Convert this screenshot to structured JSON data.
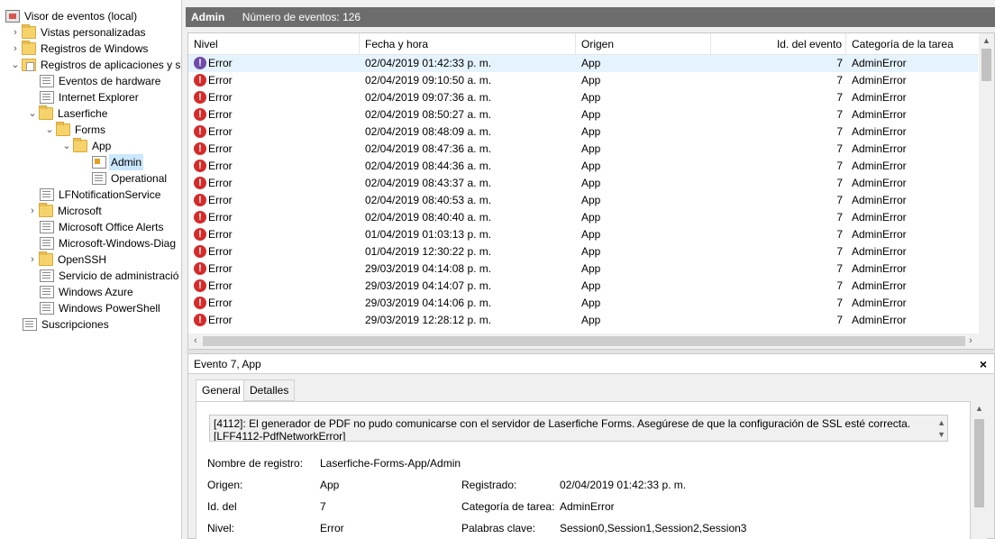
{
  "tree": {
    "items": [
      {
        "label": "Visor de eventos (local)",
        "icon": "event-viewer-icon"
      },
      {
        "label": "Vistas personalizadas",
        "icon": "folder-icon",
        "twisty": "›"
      },
      {
        "label": "Registros de Windows",
        "icon": "folder-icon",
        "twisty": "›"
      },
      {
        "label": "Registros de aplicaciones y s",
        "icon": "log-folder-icon",
        "twisty": "⌄"
      },
      {
        "label": "Eventos de hardware",
        "icon": "log-icon"
      },
      {
        "label": "Internet Explorer",
        "icon": "log-icon"
      },
      {
        "label": "Laserfiche",
        "icon": "folder-icon",
        "twisty": "⌄"
      },
      {
        "label": "Forms",
        "icon": "folder-icon",
        "twisty": "⌄"
      },
      {
        "label": "App",
        "icon": "folder-icon",
        "twisty": "⌄"
      },
      {
        "label": "Admin",
        "icon": "admin-log-icon"
      },
      {
        "label": "Operational",
        "icon": "log-icon"
      },
      {
        "label": "LFNotificationService",
        "icon": "log-icon"
      },
      {
        "label": "Microsoft",
        "icon": "folder-icon",
        "twisty": "›"
      },
      {
        "label": "Microsoft Office Alerts",
        "icon": "log-icon"
      },
      {
        "label": "Microsoft-Windows-Diag",
        "icon": "log-icon"
      },
      {
        "label": "OpenSSH",
        "icon": "folder-icon",
        "twisty": "›"
      },
      {
        "label": "Servicio de administració",
        "icon": "log-icon"
      },
      {
        "label": "Windows Azure",
        "icon": "log-icon"
      },
      {
        "label": "Windows PowerShell",
        "icon": "log-icon"
      },
      {
        "label": "Suscripciones",
        "icon": "log-icon"
      }
    ]
  },
  "header": {
    "title": "Admin",
    "count": "Número de eventos: 126"
  },
  "grid": {
    "columns": [
      "Nivel",
      "Fecha y hora",
      "Origen",
      "Id. del evento",
      "Categoría de la tarea"
    ],
    "rows": [
      {
        "level": "Error",
        "date": "02/04/2019 01:42:33 p. m.",
        "source": "App",
        "id": "7",
        "category": "AdminError"
      },
      {
        "level": "Error",
        "date": "02/04/2019 09:10:50 a. m.",
        "source": "App",
        "id": "7",
        "category": "AdminError"
      },
      {
        "level": "Error",
        "date": "02/04/2019 09:07:36 a. m.",
        "source": "App",
        "id": "7",
        "category": "AdminError"
      },
      {
        "level": "Error",
        "date": "02/04/2019 08:50:27 a. m.",
        "source": "App",
        "id": "7",
        "category": "AdminError"
      },
      {
        "level": "Error",
        "date": "02/04/2019 08:48:09 a. m.",
        "source": "App",
        "id": "7",
        "category": "AdminError"
      },
      {
        "level": "Error",
        "date": "02/04/2019 08:47:36 a. m.",
        "source": "App",
        "id": "7",
        "category": "AdminError"
      },
      {
        "level": "Error",
        "date": "02/04/2019 08:44:36 a. m.",
        "source": "App",
        "id": "7",
        "category": "AdminError"
      },
      {
        "level": "Error",
        "date": "02/04/2019 08:43:37 a. m.",
        "source": "App",
        "id": "7",
        "category": "AdminError"
      },
      {
        "level": "Error",
        "date": "02/04/2019 08:40:53 a. m.",
        "source": "App",
        "id": "7",
        "category": "AdminError"
      },
      {
        "level": "Error",
        "date": "02/04/2019 08:40:40 a. m.",
        "source": "App",
        "id": "7",
        "category": "AdminError"
      },
      {
        "level": "Error",
        "date": "01/04/2019 01:03:13 p. m.",
        "source": "App",
        "id": "7",
        "category": "AdminError"
      },
      {
        "level": "Error",
        "date": "01/04/2019 12:30:22 p. m.",
        "source": "App",
        "id": "7",
        "category": "AdminError"
      },
      {
        "level": "Error",
        "date": "29/03/2019 04:14:08 p. m.",
        "source": "App",
        "id": "7",
        "category": "AdminError"
      },
      {
        "level": "Error",
        "date": "29/03/2019 04:14:07 p. m.",
        "source": "App",
        "id": "7",
        "category": "AdminError"
      },
      {
        "level": "Error",
        "date": "29/03/2019 04:14:06 p. m.",
        "source": "App",
        "id": "7",
        "category": "AdminError"
      },
      {
        "level": "Error",
        "date": "29/03/2019 12:28:12 p. m.",
        "source": "App",
        "id": "7",
        "category": "AdminError"
      }
    ]
  },
  "detail": {
    "title": "Evento 7, App",
    "close": "×",
    "tabs": [
      "General",
      "Detalles"
    ],
    "message_line1": "[4112]: El generador de PDF no pudo comunicarse con el servidor de Laserfiche Forms. Asegúrese de que la configuración de SSL esté correcta.",
    "message_line2": "[LFF4112-PdfNetworkError]",
    "fields": {
      "log_name_label": "Nombre de registro:",
      "log_name_value": "Laserfiche-Forms-App/Admin",
      "source_label": "Origen:",
      "source_value": "App",
      "logged_label": "Registrado:",
      "logged_value": "02/04/2019 01:42:33 p. m.",
      "event_id_label": "Id. del",
      "event_id_value": "7",
      "task_cat_label": "Categoría de tarea:",
      "task_cat_value": "AdminError",
      "level_label": "Nivel:",
      "level_value": "Error",
      "keywords_label": "Palabras clave:",
      "keywords_value": "Session0,Session1,Session2,Session3"
    }
  },
  "colors": {
    "header_bg": "#6d6d6d",
    "selection": "#cce8ff",
    "error": "#d42b2b"
  }
}
